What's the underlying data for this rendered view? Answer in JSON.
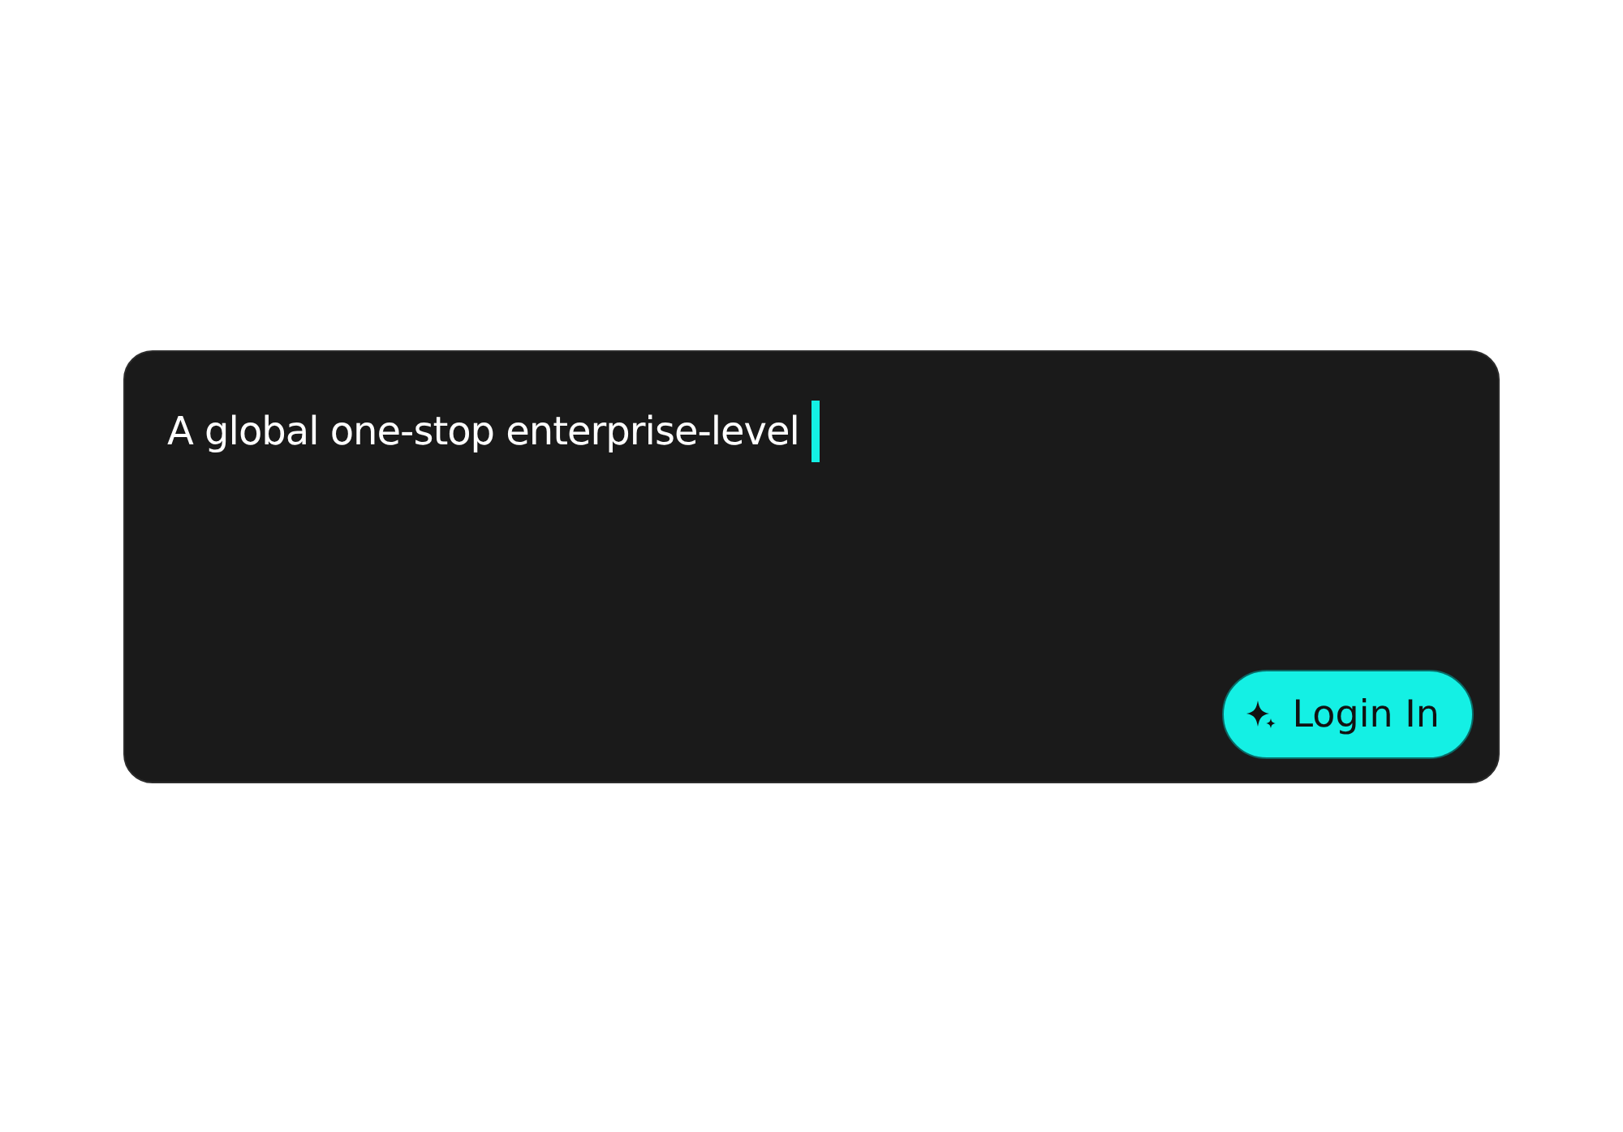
{
  "prompt": {
    "text": "A global one-stop enterprise-level",
    "cursor_visible": true
  },
  "button": {
    "label": "Login In"
  }
}
